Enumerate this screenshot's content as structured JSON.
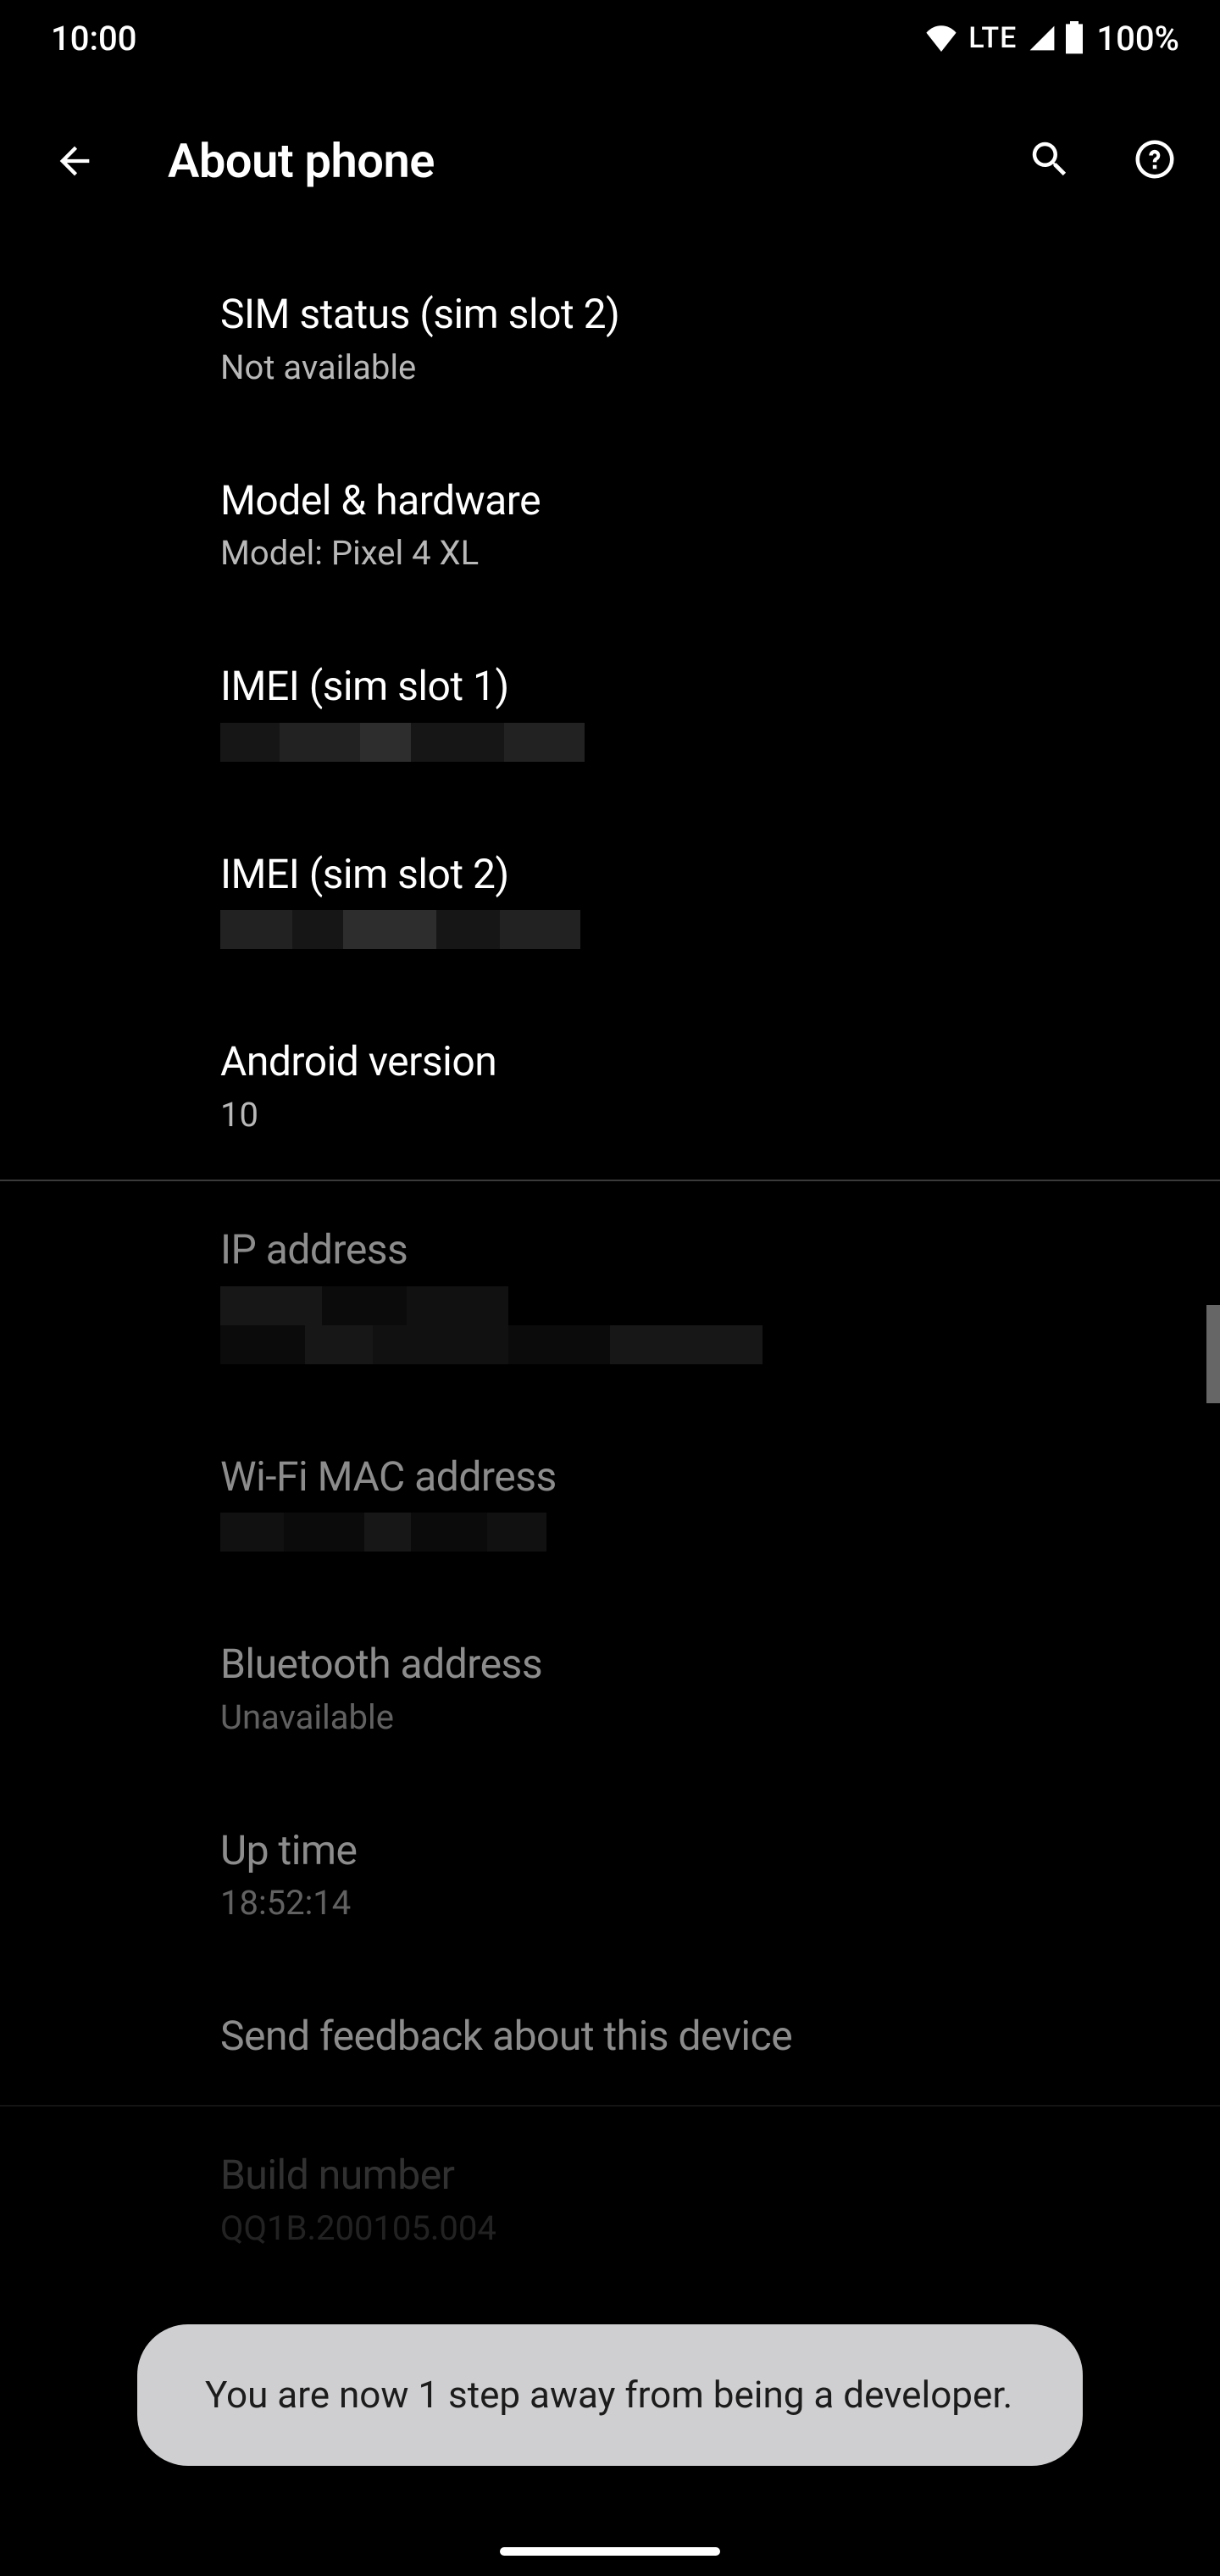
{
  "statusbar": {
    "time": "10:00",
    "network_label": "LTE",
    "battery_pct": "100%"
  },
  "appbar": {
    "title": "About phone"
  },
  "items": {
    "sim2": {
      "title": "SIM status (sim slot 2)",
      "value": "Not available"
    },
    "model": {
      "title": "Model & hardware",
      "value": "Model: Pixel 4 XL"
    },
    "imei1": {
      "title": "IMEI (sim slot 1)"
    },
    "imei2": {
      "title": "IMEI (sim slot 2)"
    },
    "android": {
      "title": "Android version",
      "value": "10"
    },
    "ip": {
      "title": "IP address"
    },
    "wifimac": {
      "title": "Wi-Fi MAC address"
    },
    "bt": {
      "title": "Bluetooth address",
      "value": "Unavailable"
    },
    "uptime": {
      "title": "Up time",
      "value": "18:52:14"
    },
    "feedback": {
      "title": "Send feedback about this device"
    },
    "build": {
      "title": "Build number",
      "value": "QQ1B.200105.004"
    }
  },
  "toast": {
    "text": "You are now 1 step away from being a developer."
  }
}
